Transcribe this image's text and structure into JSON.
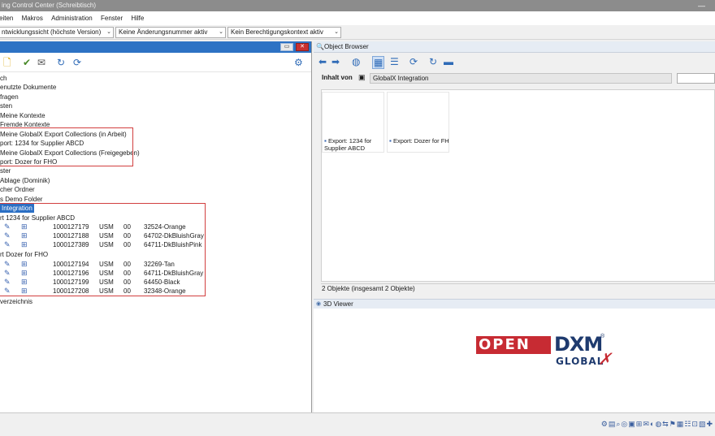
{
  "window": {
    "title": "ing Control Center (Schreibtisch)",
    "min_label": "—"
  },
  "menu": [
    "eiten",
    "Makros",
    "Administration",
    "Fenster",
    "Hilfe"
  ],
  "context": {
    "combo1": "ntwicklungssicht (höchste Version)",
    "combo2": "Keine Änderungsnummer aktiv",
    "combo3": "Kein Berechtigungskontext aktiv"
  },
  "left_panel": {
    "tree": [
      "ch",
      "enutzte Dokumente",
      "fragen",
      "sten",
      "Meine Kontexte",
      "Fremde Kontexte",
      "Meine GlobalX Export Collections (in Arbeit)",
      "port: 1234 for Supplier ABCD",
      "Meine GlobalX Export Collections (Freigegeben)",
      "port: Dozer for FHO",
      "ster",
      "Ablage (Dominik)",
      "cher Ordner",
      "s Demo Folder",
      "Integration",
      "rt 1234 for Supplier ABCD"
    ],
    "group1_rows": [
      {
        "num": "1000127179",
        "unit": "USM",
        "ver": "00",
        "desc": "32524-Orange"
      },
      {
        "num": "1000127188",
        "unit": "USM",
        "ver": "00",
        "desc": "64702-DkBluishGray"
      },
      {
        "num": "1000127389",
        "unit": "USM",
        "ver": "00",
        "desc": "64711-DkBluishPink"
      }
    ],
    "group2_label": "rt Dozer for FHO",
    "group2_rows": [
      {
        "num": "1000127194",
        "unit": "USM",
        "ver": "00",
        "desc": "32269-Tan"
      },
      {
        "num": "1000127196",
        "unit": "USM",
        "ver": "00",
        "desc": "64711-DkBluishGray"
      },
      {
        "num": "1000127199",
        "unit": "USM",
        "ver": "00",
        "desc": "64450-Black"
      },
      {
        "num": "1000127208",
        "unit": "USM",
        "ver": "00",
        "desc": "32348-Orange"
      }
    ],
    "footer_item": "verzeichnis"
  },
  "object_browser": {
    "title": "Object Browser",
    "inhalt_label": "Inhalt von",
    "inhalt_value": "GlobalX Integration",
    "tiles": [
      {
        "line1": "Export: 1234 for",
        "line2": "Supplier ABCD"
      },
      {
        "line1": "Export: Dozer for FH",
        "line2": ""
      }
    ],
    "status": "2 Objekte (insgesamt 2 Objekte)"
  },
  "viewer": {
    "title": "3D Viewer",
    "logo_open": "OPEN",
    "logo_dxm": "DXM",
    "logo_global": "GLOBAL",
    "logo_reg": "®"
  },
  "colors": {
    "accent": "#2d72c4",
    "highlight_box": "#d23f3f",
    "logo_red": "#c72b33",
    "logo_blue": "#1e3a6e"
  },
  "icons": [
    "new-doc-icon",
    "check-icon",
    "mail-icon",
    "refresh-icon",
    "sync-icon",
    "settings-gear-icon",
    "back-arrow-icon",
    "forward-arrow-icon",
    "globe-icon",
    "tile-view-icon",
    "list-view-icon",
    "refresh-circle-icon",
    "folder-icon",
    "edit-pencil-icon",
    "structure-icon"
  ]
}
